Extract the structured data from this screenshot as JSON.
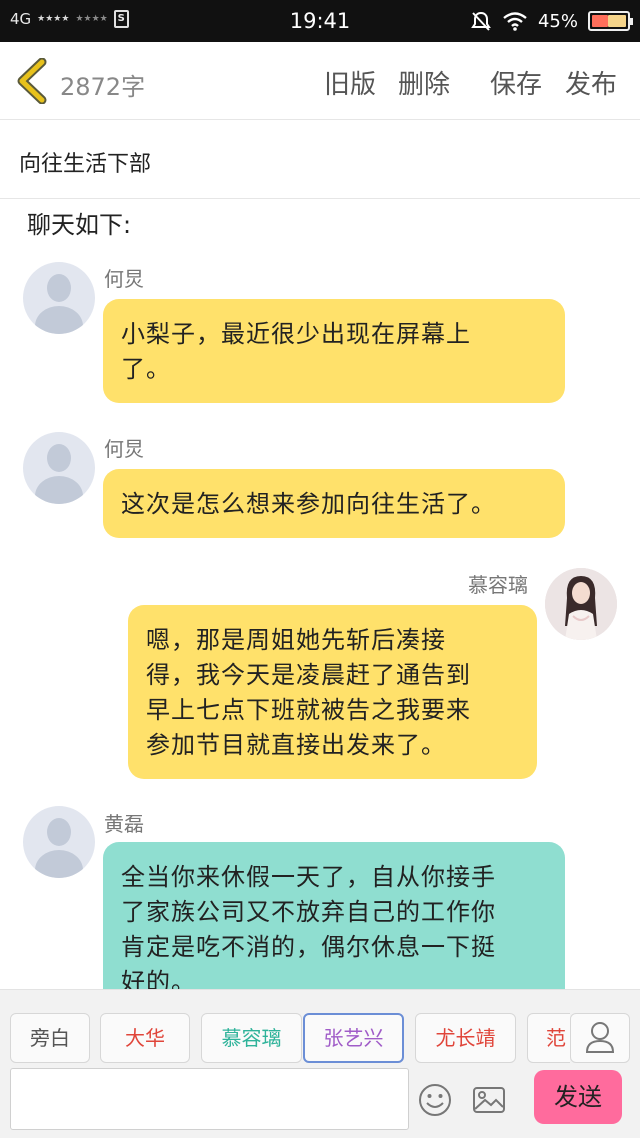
{
  "status_bar": {
    "network": "4G",
    "signal1": "★★★★",
    "signal2": "★★★★",
    "sim": "S",
    "time": "19:41",
    "battery": "45%"
  },
  "header": {
    "word_count": "2872字",
    "old_version": "旧版",
    "delete": "删除",
    "save": "保存",
    "publish": "发布"
  },
  "document": {
    "title": "向往生活下部",
    "intro": "聊天如下:"
  },
  "messages": [
    {
      "speaker": "何炅",
      "side": "left",
      "color": "yellow",
      "text": "小梨子，最近很少出现在屏幕上了。",
      "lines": [
        "小梨子，最近很少出现在屏幕上",
        "了。"
      ]
    },
    {
      "speaker": "何炅",
      "side": "left",
      "color": "yellow",
      "text": "这次是怎么想来参加向往生活了。",
      "lines": [
        "这次是怎么想来参加向往生活了。"
      ]
    },
    {
      "speaker": "慕容璃",
      "side": "right",
      "color": "yellow",
      "text": "嗯，那是周姐她先斩后凑接得，我今天是凌晨赶了通告到早上七点下班就被告之我要来参加节目就直接出发来了。",
      "lines": [
        "嗯，那是周姐她先斩后凑接",
        "得，我今天是凌晨赶了通告到",
        "早上七点下班就被告之我要来",
        "参加节目就直接出发来了。"
      ]
    },
    {
      "speaker": "黄磊",
      "side": "left",
      "color": "teal",
      "text": "全当你来休假一天了，自从你接手了家族公司又不放弃自己的工作你肯定是吃不消的，偶尔休息一下挺好的。",
      "lines": [
        "全当你来休假一天了，自从你接手",
        "了家族公司又不放弃自己的工作你",
        "肯定是吃不消的，偶尔休息一下挺",
        "好的。"
      ]
    }
  ],
  "characters": [
    {
      "label": "旁白",
      "color": "#555555"
    },
    {
      "label": "大华",
      "color": "#e0453a"
    },
    {
      "label": "慕容璃",
      "color": "#2fb39a"
    },
    {
      "label": "张艺兴",
      "color": "#a05cc8"
    },
    {
      "label": "尤长靖",
      "color": "#e0453a"
    },
    {
      "label": "范",
      "color": "#e0453a"
    }
  ],
  "composer": {
    "input_value": "",
    "send_label": "发送"
  },
  "colors": {
    "accent_back": "#e8c21c",
    "bubble_yellow": "#ffe16b",
    "bubble_teal": "#8fded0",
    "send_button": "#ff6b9d",
    "selected_chip_border": "#6b8ed6"
  },
  "icons": [
    "back-chevron-icon",
    "wifi-icon",
    "mute-icon",
    "battery-icon",
    "emoji-icon",
    "image-icon",
    "person-icon"
  ]
}
